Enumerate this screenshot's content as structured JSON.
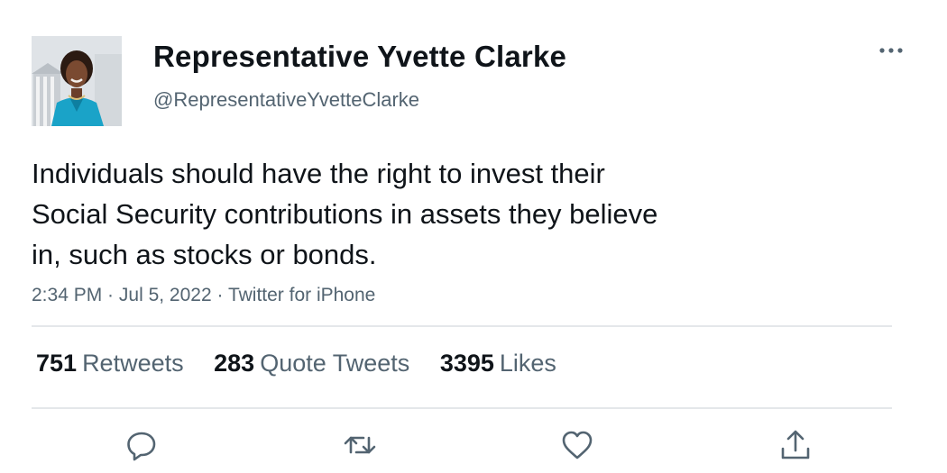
{
  "author": {
    "display_name": "Representative Yvette Clarke",
    "handle": "@RepresentativeYvetteClarke"
  },
  "tweet": {
    "lines": [
      "Individuals should have the right to invest their",
      "Social Security contributions in assets they believe",
      "in, such as stocks or bonds."
    ],
    "time": "2:34 PM",
    "date": "Jul 5, 2022",
    "source": "Twitter for iPhone",
    "separator": " · "
  },
  "stats": {
    "retweets_count": "751",
    "retweets_label": "Retweets",
    "quote_count": "283",
    "quote_label": "Quote Tweets",
    "likes_count": "3395",
    "likes_label": "Likes"
  },
  "icons": {
    "more": "more-horizontal-icon",
    "reply": "reply-icon",
    "retweet": "retweet-icon",
    "like": "heart-icon",
    "share": "share-icon"
  },
  "colors": {
    "text_primary": "#0f1419",
    "text_secondary": "#536471",
    "divider": "#e4e7ea",
    "avatar_jacket": "#1aa3c8"
  }
}
